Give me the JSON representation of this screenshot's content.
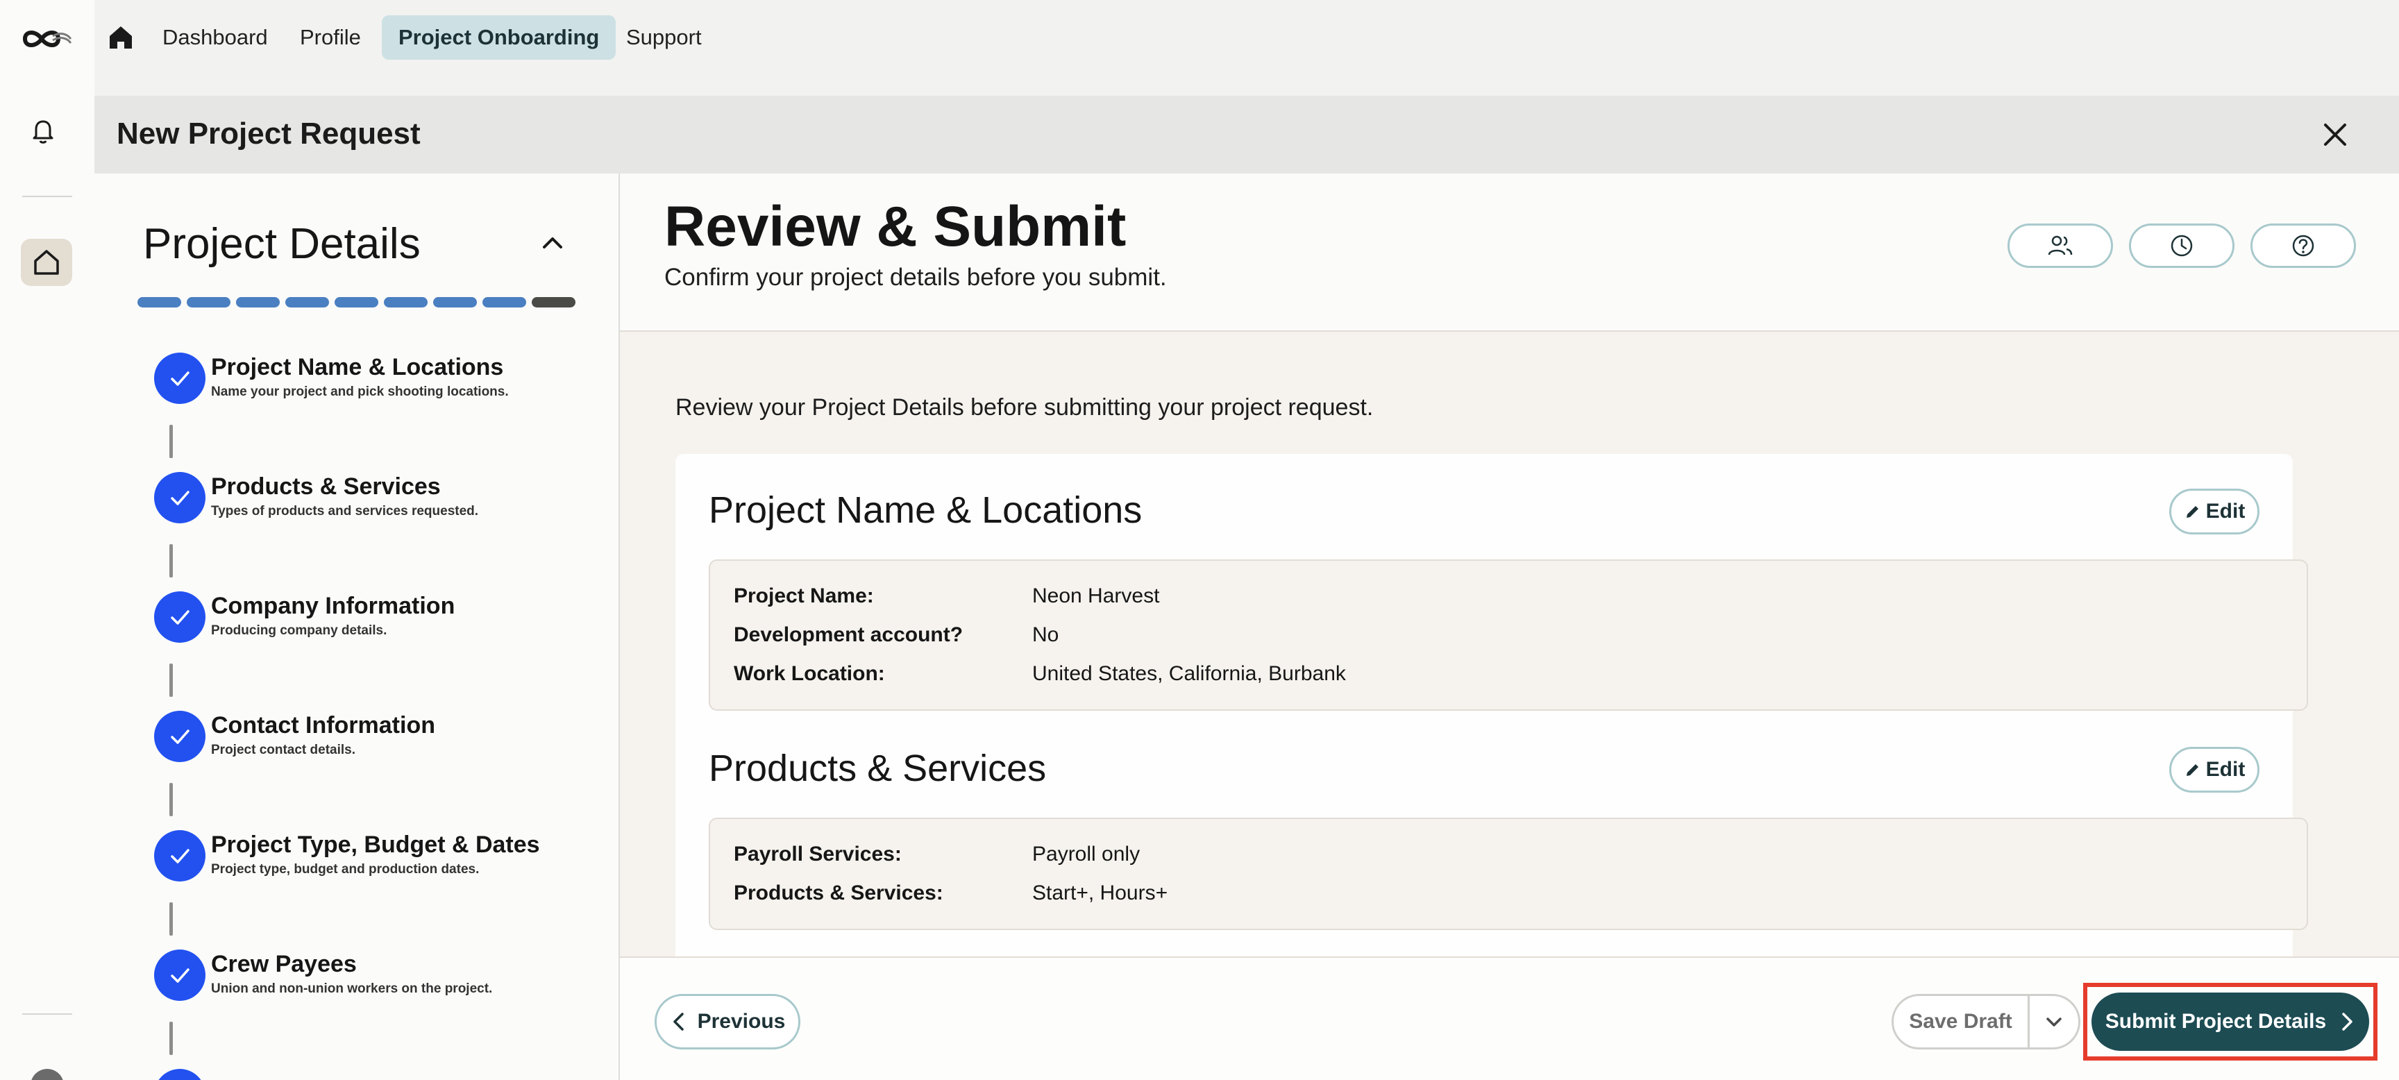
{
  "nav": {
    "items": [
      {
        "label": "Dashboard",
        "active": false
      },
      {
        "label": "Profile",
        "active": false
      },
      {
        "label": "Project Onboarding",
        "active": true
      },
      {
        "label": "Support",
        "active": false
      }
    ]
  },
  "modal": {
    "title": "New Project Request"
  },
  "steps_panel": {
    "heading": "Project Details",
    "progress": {
      "completed": 8,
      "current": 9,
      "total": 9
    },
    "steps": [
      {
        "title": "Project Name & Locations",
        "desc": "Name your project and pick shooting locations.",
        "done": true
      },
      {
        "title": "Products & Services",
        "desc": "Types of products and services requested.",
        "done": true
      },
      {
        "title": "Company Information",
        "desc": "Producing company details.",
        "done": true
      },
      {
        "title": "Contact Information",
        "desc": "Project contact details.",
        "done": true
      },
      {
        "title": "Project Type, Budget & Dates",
        "desc": "Project type, budget and production dates.",
        "done": true
      },
      {
        "title": "Crew Payees",
        "desc": "Union and non-union workers on the project.",
        "done": true
      }
    ]
  },
  "main": {
    "title": "Review & Submit",
    "subtitle": "Confirm your project details before you submit.",
    "intro": "Review your Project Details before submitting your project request.",
    "edit_label": "Edit",
    "sections": [
      {
        "title": "Project Name & Locations",
        "rows": [
          {
            "key": "Project Name:",
            "value": "Neon Harvest"
          },
          {
            "key": "Development account?",
            "value": "No"
          },
          {
            "key": "Work Location:",
            "value": "United States, California, Burbank"
          }
        ]
      },
      {
        "title": "Products & Services",
        "rows": [
          {
            "key": "Payroll Services:",
            "value": "Payroll only"
          },
          {
            "key": "Products & Services:",
            "value": "Start+, Hours+"
          }
        ]
      }
    ]
  },
  "footer": {
    "previous_label": "Previous",
    "save_draft_label": "Save Draft",
    "submit_label": "Submit Project Details"
  },
  "colors": {
    "accent": "#1d4c53",
    "step_check": "#2251f0",
    "progress": "#4a7fc1",
    "nav_active": "#cde1e4",
    "highlight": "#e53c2c"
  }
}
